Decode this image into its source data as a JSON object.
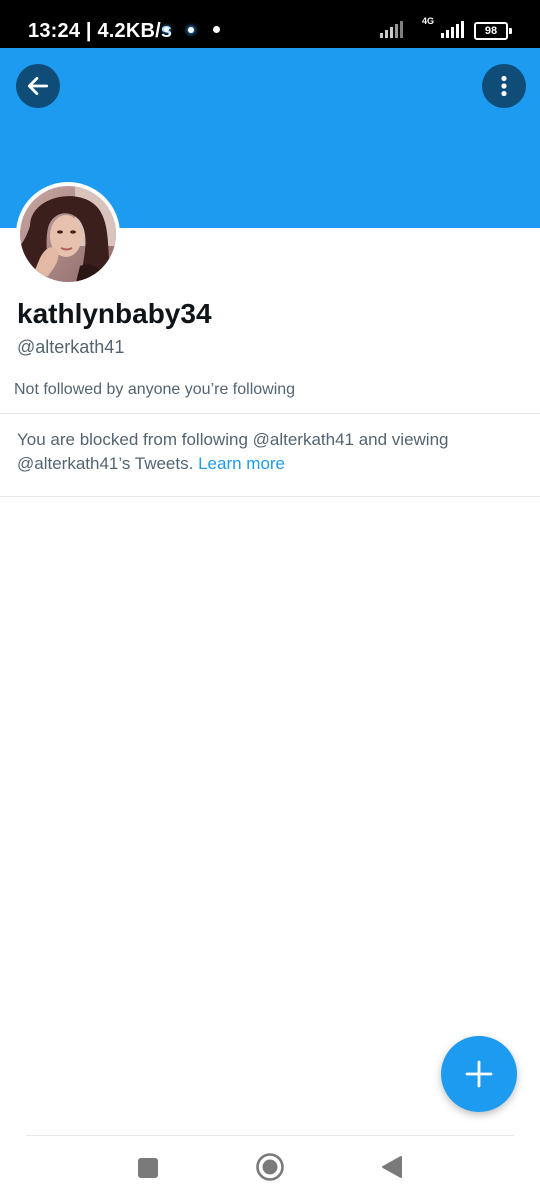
{
  "status_bar": {
    "time_speed": "13:24 | 4.2KB/s",
    "network": "4G",
    "battery": "98"
  },
  "header": {
    "back_icon": "arrow-left-icon",
    "more_icon": "more-vertical-icon",
    "banner_color": "#1d9bf0"
  },
  "profile": {
    "display_name": "kathlynbaby34",
    "handle": "@alterkath41",
    "follow_note": "Not followed by anyone you’re following",
    "blocked_message": "You are blocked from following @alterkath41 and viewing @alterkath41’s Tweets.",
    "learn_more": "Learn more"
  },
  "fab": {
    "icon": "plus-icon"
  },
  "nav": {
    "recents_icon": "square-icon",
    "home_icon": "home-circle-icon",
    "back_icon": "triangle-back-icon"
  },
  "colors": {
    "accent": "#1d9bf0",
    "secondary_text": "#536471",
    "primary_text": "#0f1419"
  }
}
